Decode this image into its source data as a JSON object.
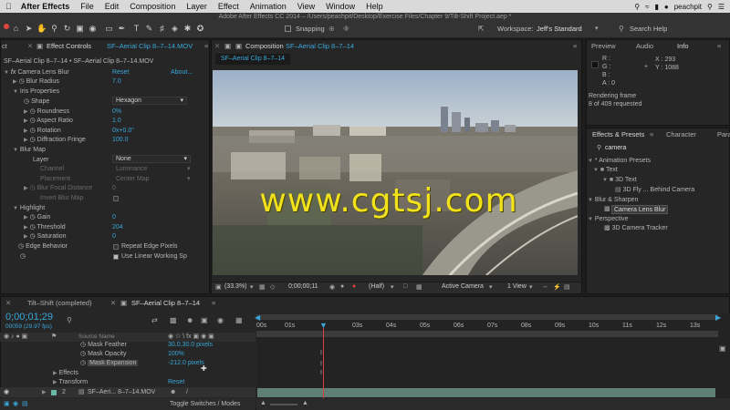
{
  "menubar": {
    "app_name": "After Effects",
    "items": [
      "File",
      "Edit",
      "Composition",
      "Layer",
      "Effect",
      "Animation",
      "View",
      "Window",
      "Help"
    ],
    "right_user": "peachpit"
  },
  "window_title": "Adobe After Effects CC 2014 – /Users/peachpit/Desktop/Exercise Files/Chapter 9/Tilt-Shift Project.aep *",
  "toolbar": {
    "snapping_label": "Snapping",
    "workspace_label": "Workspace:",
    "workspace_value": "Jeff's Standard",
    "search_help_placeholder": "Search Help"
  },
  "effect_controls": {
    "tab_prefix": "ct",
    "tab_label": "Effect Controls",
    "tab_layer": "SF–Aerial Clip 8–7–14.MOV",
    "breadcrumb": "SF–Aerial Clip 8–7–14 • SF–Aerial Clip 8–7–14.MOV",
    "effect_name": "Camera Lens Blur",
    "reset_label": "Reset",
    "about_label": "About...",
    "blur_radius_label": "Blur Radius",
    "blur_radius_value": "7.0",
    "iris_label": "Iris Properties",
    "shape_label": "Shape",
    "shape_value": "Hexagon",
    "roundness_label": "Roundness",
    "roundness_value": "0%",
    "aspect_label": "Aspect Ratio",
    "aspect_value": "1.0",
    "rotation_label": "Rotation",
    "rotation_value": "0x+0.0°",
    "diffraction_label": "Diffraction Fringe",
    "diffraction_value": "100.0",
    "blurmap_label": "Blur Map",
    "layer_label": "Layer",
    "layer_value": "None",
    "channel_label": "Channel",
    "channel_value": "Luminance",
    "placement_label": "Placement",
    "placement_value": "Center Map",
    "focal_label": "Blur Focal Distance",
    "focal_value": "0",
    "invert_label": "Invert Blur Map",
    "highlight_label": "Highlight",
    "gain_label": "Gain",
    "gain_value": "0",
    "threshold_label": "Threshold",
    "threshold_value": "204",
    "saturation_label": "Saturation",
    "saturation_value": "0",
    "edge_label": "Edge Behavior",
    "repeat_label": "Repeat Edge Pixels",
    "linear_label": "Use Linear Working Sp"
  },
  "composition": {
    "tab_label": "Composition",
    "tab_name": "SF–Aerial Clip 8–7–14",
    "subtab": "SF–Aerial Clip 8–7–14",
    "zoom": "(33.3%)",
    "timecode": "0;00;00;11",
    "resolution": "(Half)",
    "camera": "Active Camera",
    "view": "1 View"
  },
  "watermark": "www.cgtsj.com",
  "info": {
    "tabs": [
      "Preview",
      "Audio",
      "Info"
    ],
    "r_label": "R :",
    "g_label": "G :",
    "b_label": "B :",
    "a_label": "A : 0",
    "x_label": "X : 293",
    "y_label": "Y : 1088",
    "rendering": "Rendering frame",
    "requested": "8 of 409 requested"
  },
  "effects_presets": {
    "tabs": [
      "Effects & Presets",
      "Character",
      "Para"
    ],
    "search_value": "camera",
    "animation_presets": "* Animation Presets",
    "text": "Text",
    "text_3d": "3D Text",
    "fly": "3D Fly ... Behind Camera",
    "blur_sharpen": "Blur & Sharpen",
    "camera_lens_blur": "Camera Lens Blur",
    "perspective": "Perspective",
    "camera_tracker": "3D Camera Tracker"
  },
  "timeline": {
    "tab1": "Tilt–Shift (completed)",
    "tab2": "SF–Aerial Clip 8–7–14",
    "timecode": "0;00;01;29",
    "frame_info": "00059 (29.97 fps)",
    "source_name_header": "Source Name",
    "rows": [
      {
        "label": "Mask Feather",
        "value": "30.0,30.0 pixels"
      },
      {
        "label": "Mask Opacity",
        "value": "100%"
      },
      {
        "label": "Mask Expansion",
        "value": "-212.0 pixels"
      }
    ],
    "effects_label": "Effects",
    "transform_label": "Transform",
    "transform_reset": "Reset",
    "layer_num": "2",
    "layer_name": "SF–Aeri... 8–7–14.MOV",
    "toggle_label": "Toggle Switches / Modes",
    "ruler": [
      "00s",
      "01s",
      "02s",
      "03s",
      "04s",
      "05s",
      "06s",
      "07s",
      "08s",
      "09s",
      "10s",
      "11s",
      "12s",
      "13s"
    ]
  }
}
